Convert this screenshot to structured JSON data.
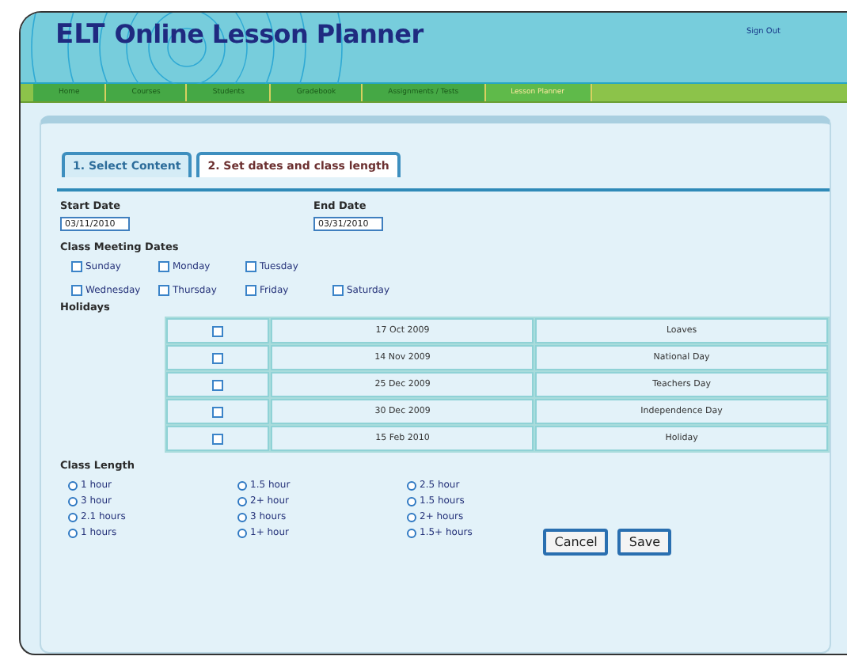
{
  "header": {
    "logo_prefix": "ELT",
    "title": "Online Lesson Planner",
    "sign_out": "Sign Out"
  },
  "nav": [
    {
      "label": "Home",
      "selected": false
    },
    {
      "label": "Courses",
      "selected": false
    },
    {
      "label": "Students",
      "selected": false
    },
    {
      "label": "Gradebook",
      "selected": false
    },
    {
      "label": "Assignments / Tests",
      "selected": false
    },
    {
      "label": "Lesson Planner",
      "selected": true
    }
  ],
  "tabs": [
    {
      "label": "1. Select Content",
      "selected": false
    },
    {
      "label": "2. Set dates and class length",
      "selected": true
    }
  ],
  "start_date": {
    "label": "Start Date",
    "value": "03/11/2010"
  },
  "end_date": {
    "label": "End Date",
    "value": "03/31/2010"
  },
  "meeting_dates": {
    "label": "Class Meeting Dates",
    "rows": [
      [
        {
          "label": "Sunday",
          "checked": false
        },
        {
          "label": "Monday",
          "checked": false
        },
        {
          "label": "Tuesday",
          "checked": false
        }
      ],
      [
        {
          "label": "Wednesday",
          "checked": false
        },
        {
          "label": "Thursday",
          "checked": false
        },
        {
          "label": "Friday",
          "checked": false
        },
        {
          "label": "Saturday",
          "checked": false
        }
      ]
    ]
  },
  "holidays": {
    "label": "Holidays",
    "rows": [
      {
        "checked": false,
        "date": "17 Oct 2009",
        "name": "Loaves"
      },
      {
        "checked": false,
        "date": "14 Nov 2009",
        "name": "National Day"
      },
      {
        "checked": false,
        "date": "25 Dec 2009",
        "name": "Teachers Day"
      },
      {
        "checked": false,
        "date": "30 Dec 2009",
        "name": "Independence Day"
      },
      {
        "checked": false,
        "date": "15 Feb 2010",
        "name": "Holiday"
      }
    ]
  },
  "class_length": {
    "label": "Class Length",
    "options": [
      {
        "label": "1 hour",
        "selected": false
      },
      {
        "label": "1.5 hour",
        "selected": false
      },
      {
        "label": "2.5 hour",
        "selected": false
      },
      {
        "label": "3 hour",
        "selected": false
      },
      {
        "label": "2+ hour",
        "selected": false
      },
      {
        "label": "1.5 hours",
        "selected": false
      },
      {
        "label": "2.1 hours",
        "selected": false
      },
      {
        "label": "3 hours",
        "selected": false
      },
      {
        "label": "2+ hours",
        "selected": false
      },
      {
        "label": "1 hours",
        "selected": false
      },
      {
        "label": "1+ hour",
        "selected": false
      },
      {
        "label": "1.5+ hours",
        "selected": false
      }
    ]
  },
  "buttons": [
    "Cancel",
    "Save"
  ]
}
